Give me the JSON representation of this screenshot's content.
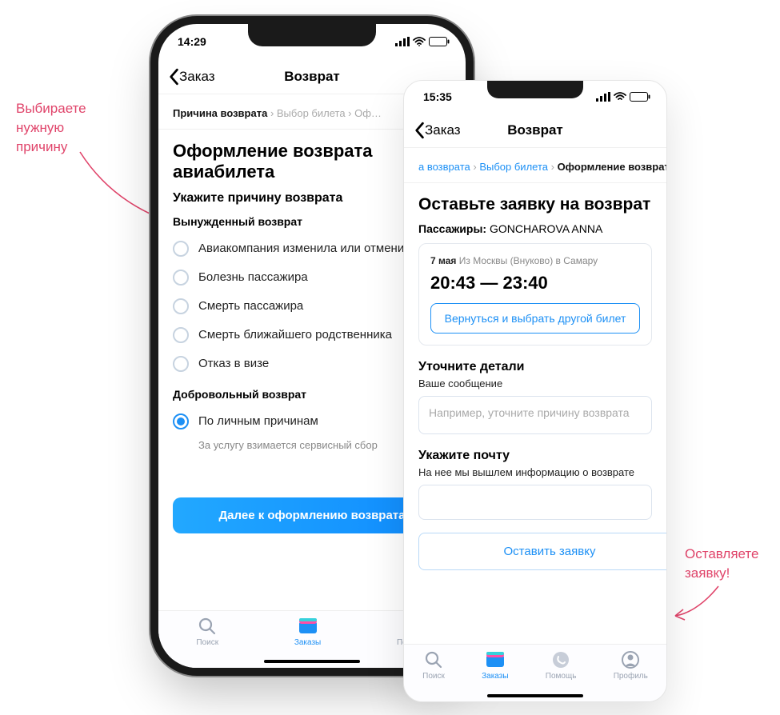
{
  "annotations": {
    "left": "Выбираете нужную причину",
    "right": "Оставляете заявку!"
  },
  "phone1": {
    "time": "14:29",
    "nav_back": "Заказ",
    "nav_title": "Возврат",
    "crumbs": {
      "c1": "Причина возврата",
      "c2": "Выбор билета",
      "c3": "Оф…"
    },
    "h1": "Оформление возврата авиабилета",
    "sub": "Укажите причину возврата",
    "group1": "Вынужденный возврат",
    "opts1": [
      "Авиакомпания изменила или отменила рейс",
      "Болезнь пассажира",
      "Смерть пассажира",
      "Смерть ближайшего родственника",
      "Отказ в визе"
    ],
    "group2": "Добровольный возврат",
    "opt2": "По личным причинам",
    "note": "За услугу взимается сервисный сбор",
    "cta": "Далее к оформлению возврата",
    "tabs": {
      "search": "Поиск",
      "orders": "Заказы",
      "help": "Помощь"
    }
  },
  "phone2": {
    "time": "15:35",
    "nav_back": "Заказ",
    "nav_title": "Возврат",
    "crumbs": {
      "c1": "а возврата",
      "c2": "Выбор билета",
      "c3": "Оформление возврата"
    },
    "h1": "Оставьте заявку на возврат",
    "pass_label": "Пассажиры:",
    "pass_name": "GONCHAROVA ANNA",
    "card": {
      "date": "7 мая",
      "route": "Из Москвы (Внуково) в Самару",
      "time": "20:43 — 23:40",
      "btn": "Вернуться и выбрать другой билет"
    },
    "details_h": "Уточните детали",
    "details_sub": "Ваше сообщение",
    "details_ph": "Например, уточните причину возврата",
    "email_h": "Укажите почту",
    "email_sub": "На нее мы вышлем информацию о возврате",
    "submit": "Оставить заявку",
    "tabs": {
      "search": "Поиск",
      "orders": "Заказы",
      "help": "Помощь",
      "profile": "Профиль"
    }
  }
}
